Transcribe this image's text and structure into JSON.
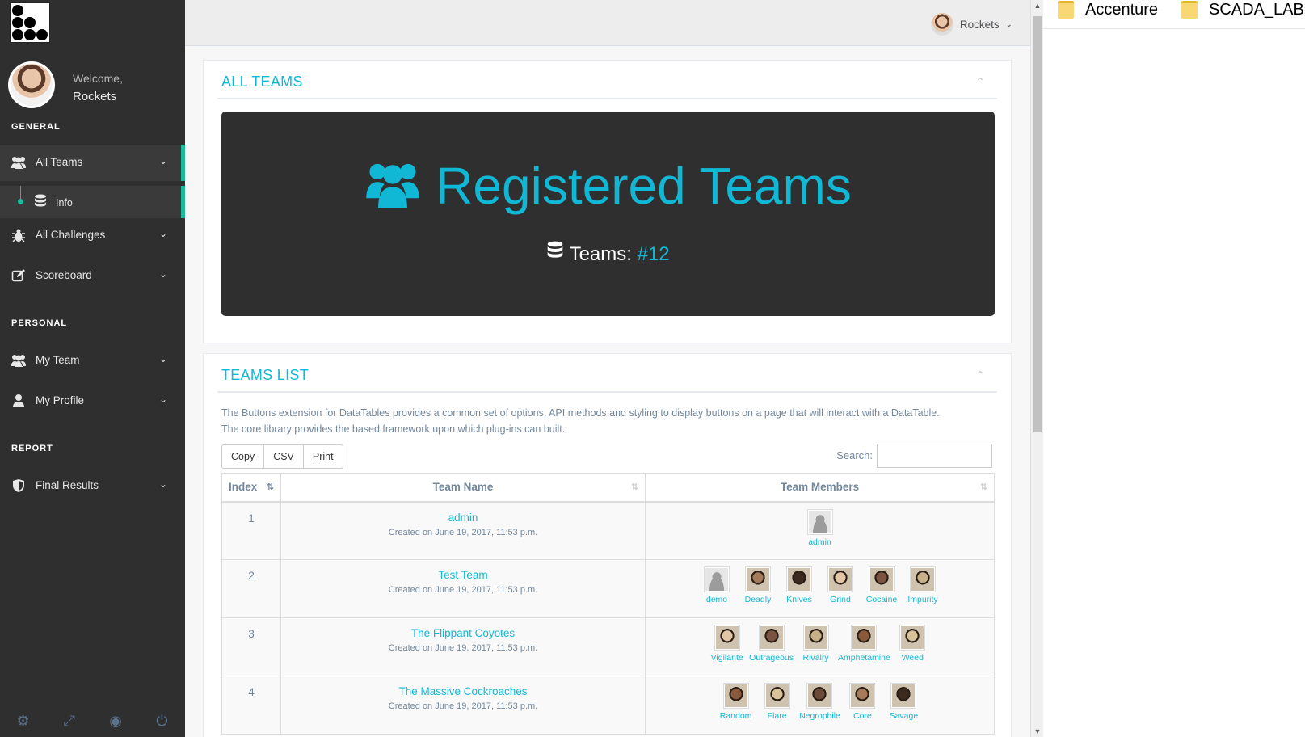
{
  "sidebar": {
    "welcome": "Welcome,",
    "user_name": "Rockets",
    "sections": {
      "general": "GENERAL",
      "personal": "PERSONAL",
      "report": "REPORT"
    },
    "items": [
      {
        "label": "All Teams",
        "icon": "users-icon"
      },
      {
        "label": "Info",
        "icon": "database-icon"
      },
      {
        "label": "All Challenges",
        "icon": "bug-icon"
      },
      {
        "label": "Scoreboard",
        "icon": "edit-icon"
      },
      {
        "label": "My Team",
        "icon": "users-icon"
      },
      {
        "label": "My Profile",
        "icon": "user-icon"
      },
      {
        "label": "Final Results",
        "icon": "shield-icon"
      }
    ],
    "footer_icons": [
      "gear-icon",
      "fullscreen-icon",
      "eye-slash-icon",
      "power-icon"
    ]
  },
  "topnav": {
    "user": "Rockets"
  },
  "all_teams": {
    "title": "ALL TEAMS",
    "hero_title": "Registered Teams",
    "count_label": "Teams:",
    "count_value": "#12"
  },
  "teams_list": {
    "title": "TEAMS LIST",
    "description_1": "The Buttons extension for DataTables provides a common set of options, API methods and styling to display buttons on a page that will interact with a DataTable.",
    "description_2": "The core library provides the based framework upon which plug-ins can built.",
    "buttons": {
      "copy": "Copy",
      "csv": "CSV",
      "print": "Print"
    },
    "search_label": "Search:",
    "columns": {
      "index": "Index",
      "team_name": "Team Name",
      "members": "Team Members"
    },
    "rows": [
      {
        "index": "1",
        "name": "admin",
        "created": "Created on June 19, 2017, 11:53 p.m.",
        "members": [
          "admin"
        ]
      },
      {
        "index": "2",
        "name": "Test Team",
        "created": "Created on June 19, 2017, 11:53 p.m.",
        "members": [
          "demo",
          "Deadly",
          "Knives",
          "Grind",
          "Cocaine",
          "Impurity"
        ]
      },
      {
        "index": "3",
        "name": "The Flippant Coyotes",
        "created": "Created on June 19, 2017, 11:53 p.m.",
        "members": [
          "Vigilante",
          "Outrageous",
          "Rivalry",
          "Amphetamine",
          "Weed"
        ]
      },
      {
        "index": "4",
        "name": "The Massive Cockroaches",
        "created": "Created on June 19, 2017, 11:53 p.m.",
        "members": [
          "Random",
          "Flare",
          "Negrophile",
          "Core",
          "Savage"
        ]
      }
    ]
  },
  "explorer": {
    "folders": [
      "Accenture",
      "SCADA_LAB"
    ]
  },
  "colors": {
    "accent": "#11b8d6",
    "sidebar_bg": "#2f2f2f",
    "active_border": "#1abb9c"
  }
}
